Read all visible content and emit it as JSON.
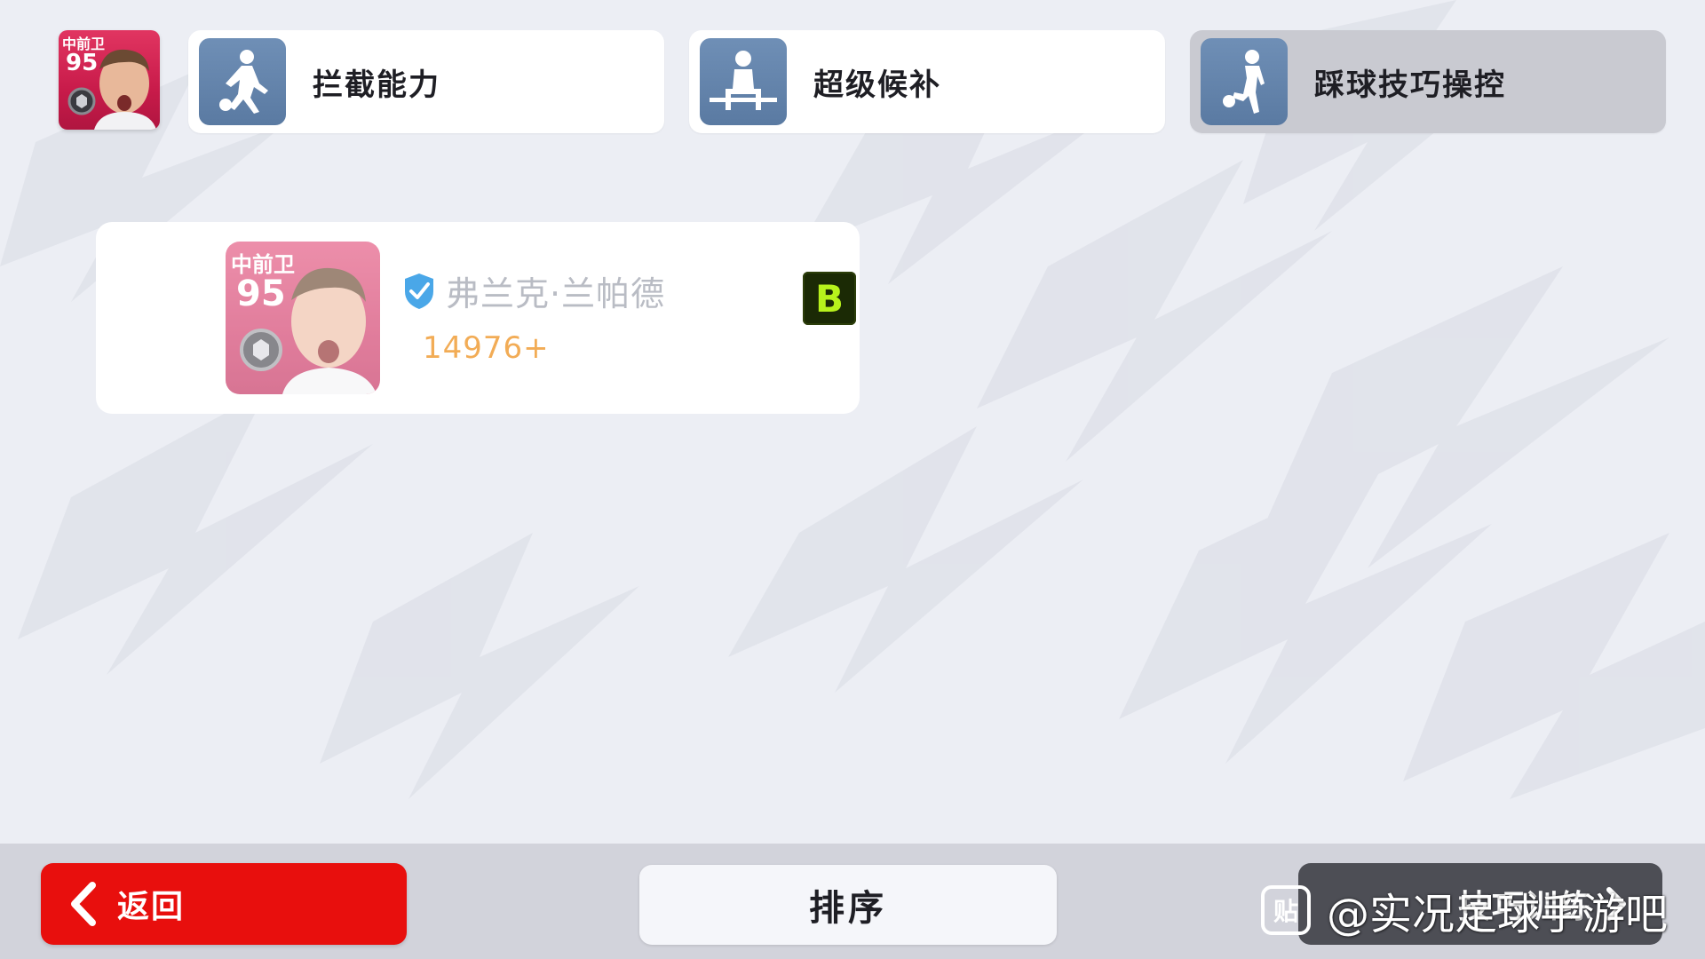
{
  "top_player": {
    "position": "中前卫",
    "rating": "95"
  },
  "skills": [
    {
      "label": "拦截能力",
      "icon": "interception-player-icon",
      "selected": false
    },
    {
      "label": "超级候补",
      "icon": "super-sub-player-icon",
      "selected": false
    },
    {
      "label": "踩球技巧操控",
      "icon": "sole-control-player-icon",
      "selected": true
    }
  ],
  "player_list": [
    {
      "position": "中前卫",
      "rating": "95",
      "name": "弗兰克·兰帕德",
      "points": "14976+",
      "grade": "B",
      "verified_icon": "shield-check-icon"
    }
  ],
  "bottom_bar": {
    "back_label": "返回",
    "sort_label": "排序",
    "skill_training_label": "技巧训练"
  },
  "watermark": {
    "icon_text": "贴",
    "text": "@实况足球手游吧"
  },
  "colors": {
    "back_button": "#e80f0d",
    "points": "#f2ac56",
    "grade_bg": "#1b2a05",
    "grade_text": "#b7f21c",
    "skill_icon_bg": "#6f8fb6",
    "player_card_pink": "#d64c77",
    "verified_blue": "#4aa7e8"
  }
}
